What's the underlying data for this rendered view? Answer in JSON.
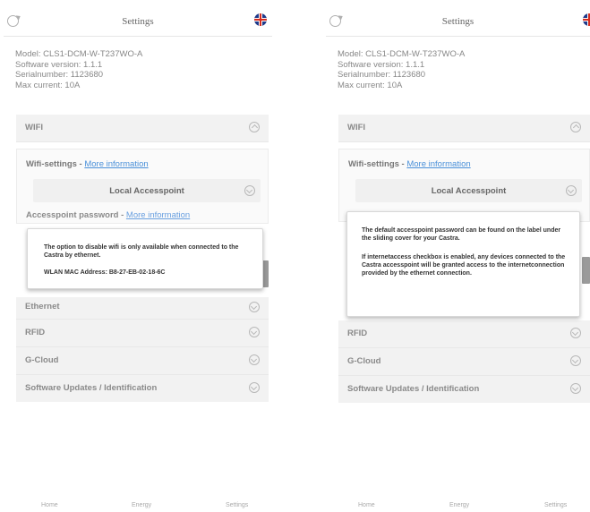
{
  "left": {
    "header": {
      "title": "Settings"
    },
    "device_info": {
      "model": "Model: CLS1-DCM-W-T237WO-A",
      "software_version": "Software version: 1.1.1",
      "serial_number": "Serialnumber: 1123680",
      "max_current": "Max current: 10A"
    },
    "wifi": {
      "label": "WIFI",
      "settings_label": "Wifi-settings - ",
      "settings_link": "More information",
      "mode_value": "Local Accesspoint",
      "password_label": "Accesspoint password - ",
      "password_link": "More information"
    },
    "sections": [
      "Ethernet",
      "RFID",
      "G-Cloud",
      "Software Updates / Identification"
    ],
    "popup": {
      "line1": "The option to disable wifi is only available when connected to the Castra by ethernet.",
      "line2": "WLAN MAC Address: B8-27-EB-02-18-6C"
    },
    "nav": {
      "home": "Home",
      "energy": "Energy",
      "settings": "Settings"
    }
  },
  "right": {
    "header": {
      "title": "Settings"
    },
    "device_info": {
      "model": "Model: CLS1-DCM-W-T237WO-A",
      "software_version": "Software version: 1.1.1",
      "serial_number": "Serialnumber: 1123680",
      "max_current": "Max current: 10A"
    },
    "wifi": {
      "label": "WIFI",
      "settings_label": "Wifi-settings - ",
      "settings_link": "More information",
      "mode_value": "Local Accesspoint"
    },
    "sections": [
      "RFID",
      "G-Cloud",
      "Software Updates / Identification"
    ],
    "popup": {
      "line1": "The default accesspoint password can be found on the label under the sliding cover for your Castra.",
      "line2": "If internetaccess checkbox is enabled, any devices connected to the Castra accesspoint will be granted access to the internetconnection provided by the ethernet connection."
    },
    "nav": {
      "home": "Home",
      "energy": "Energy",
      "settings": "Settings"
    }
  }
}
